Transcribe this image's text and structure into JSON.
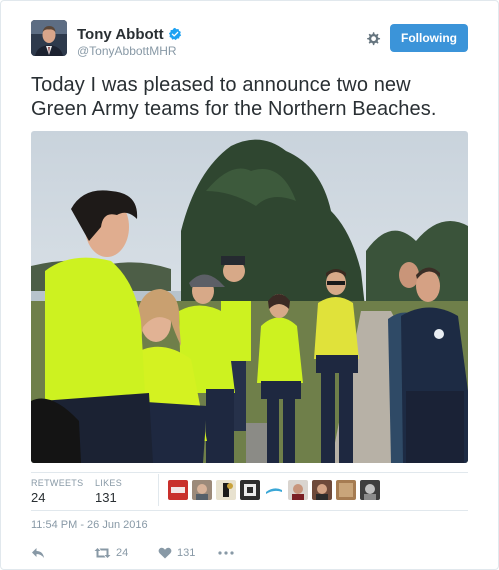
{
  "user": {
    "name": "Tony Abbott",
    "handle": "@TonyAbbottMHR"
  },
  "follow_button": {
    "label": "Following",
    "color": "#3b94d9"
  },
  "tweet": {
    "text_line1": "Today I was pleased to announce two new",
    "text_line2": "Green Army teams for the Northern Beaches."
  },
  "stats": {
    "retweets_label": "RETWEETS",
    "retweets_value": "24",
    "likes_label": "LIKES",
    "likes_value": "131"
  },
  "timestamp": "11:54 PM - 26 Jun 2016",
  "actions": {
    "retweet_count": "24",
    "like_count": "131"
  },
  "icons": [
    "verified-badge-icon",
    "gear-icon",
    "reply-icon",
    "retweet-icon",
    "heart-icon",
    "more-icon"
  ],
  "colors": {
    "accent": "#3b94d9",
    "muted": "#8899a6",
    "text": "#292f33",
    "vest_yellow": "#d4ff1e"
  }
}
